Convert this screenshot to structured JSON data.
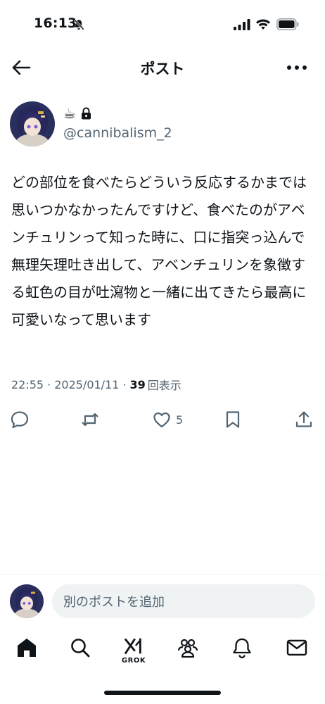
{
  "status_bar": {
    "time": "16:13"
  },
  "header": {
    "title": "ポスト"
  },
  "author": {
    "emoji": "☕",
    "handle": "@cannibalism_2"
  },
  "post": {
    "text": "どの部位を食べたらどういう反応するかまでは思いつかなかったんですけど、食べたのがアベンチュリンって知った時に、口に指突っ込んで無理矢理吐き出して、アベンチュリンを象徴する虹色の目が吐瀉物と一緒に出てきたら最高に可愛いなって思います",
    "time": "22:55",
    "date": "2025/01/11",
    "views_count": "39",
    "views_label": "回表示",
    "separator": "·"
  },
  "actions": {
    "like_count": "5"
  },
  "composer": {
    "placeholder": "別のポストを追加"
  },
  "tabbar": {
    "grok_label": "GROK"
  },
  "colors": {
    "text": "#0f1419",
    "secondary": "#536471",
    "input_bg": "#eff3f4"
  }
}
